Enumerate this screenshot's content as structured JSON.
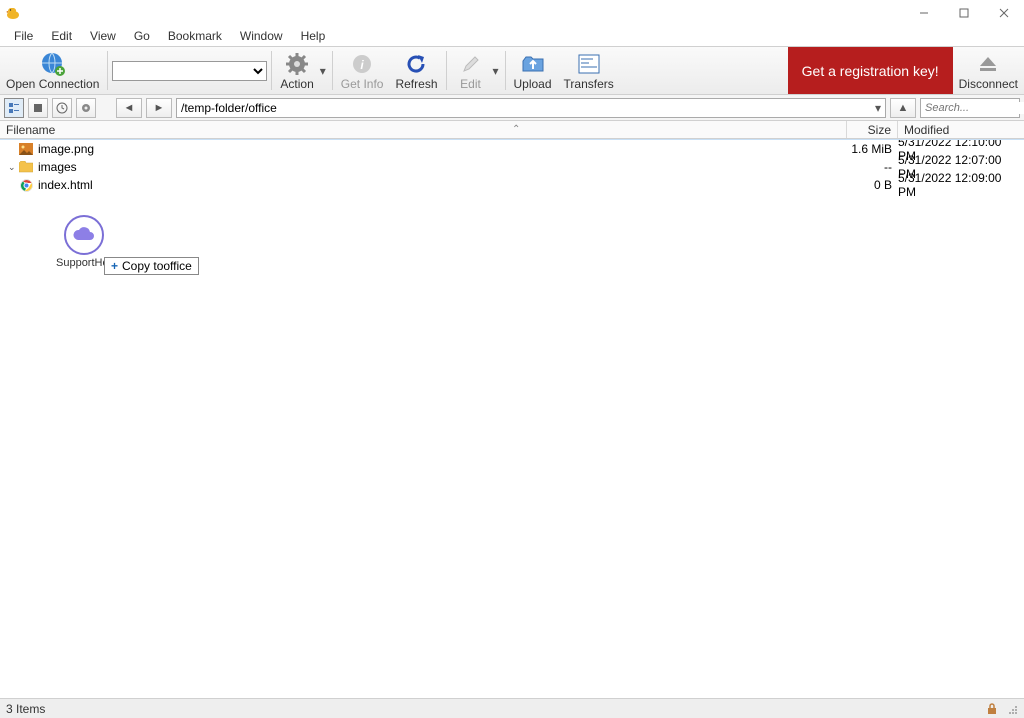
{
  "menubar": [
    "File",
    "Edit",
    "View",
    "Go",
    "Bookmark",
    "Window",
    "Help"
  ],
  "toolbar": {
    "open_connection": "Open Connection",
    "action": "Action",
    "get_info": "Get Info",
    "refresh": "Refresh",
    "edit": "Edit",
    "upload": "Upload",
    "transfers": "Transfers",
    "reg_key": "Get a registration key!",
    "disconnect": "Disconnect"
  },
  "nav": {
    "path": "/temp-folder/office",
    "search_placeholder": "Search..."
  },
  "columns": {
    "filename": "Filename",
    "size": "Size",
    "modified": "Modified"
  },
  "files": [
    {
      "icon": "image-icon",
      "name": "image.png",
      "size": "1.6 MiB",
      "modified": "5/31/2022 12:10:00 PM",
      "expandable": false
    },
    {
      "icon": "folder-icon",
      "name": "images",
      "size": "--",
      "modified": "5/31/2022 12:07:00 PM",
      "expandable": true
    },
    {
      "icon": "chrome-icon",
      "name": "index.html",
      "size": "0 B",
      "modified": "5/31/2022 12:09:00 PM",
      "expandable": false
    }
  ],
  "drag": {
    "label": "SupportHost",
    "tip_prefix": "Copy to ",
    "tip_target": "office"
  },
  "status": {
    "items": "3 Items"
  }
}
